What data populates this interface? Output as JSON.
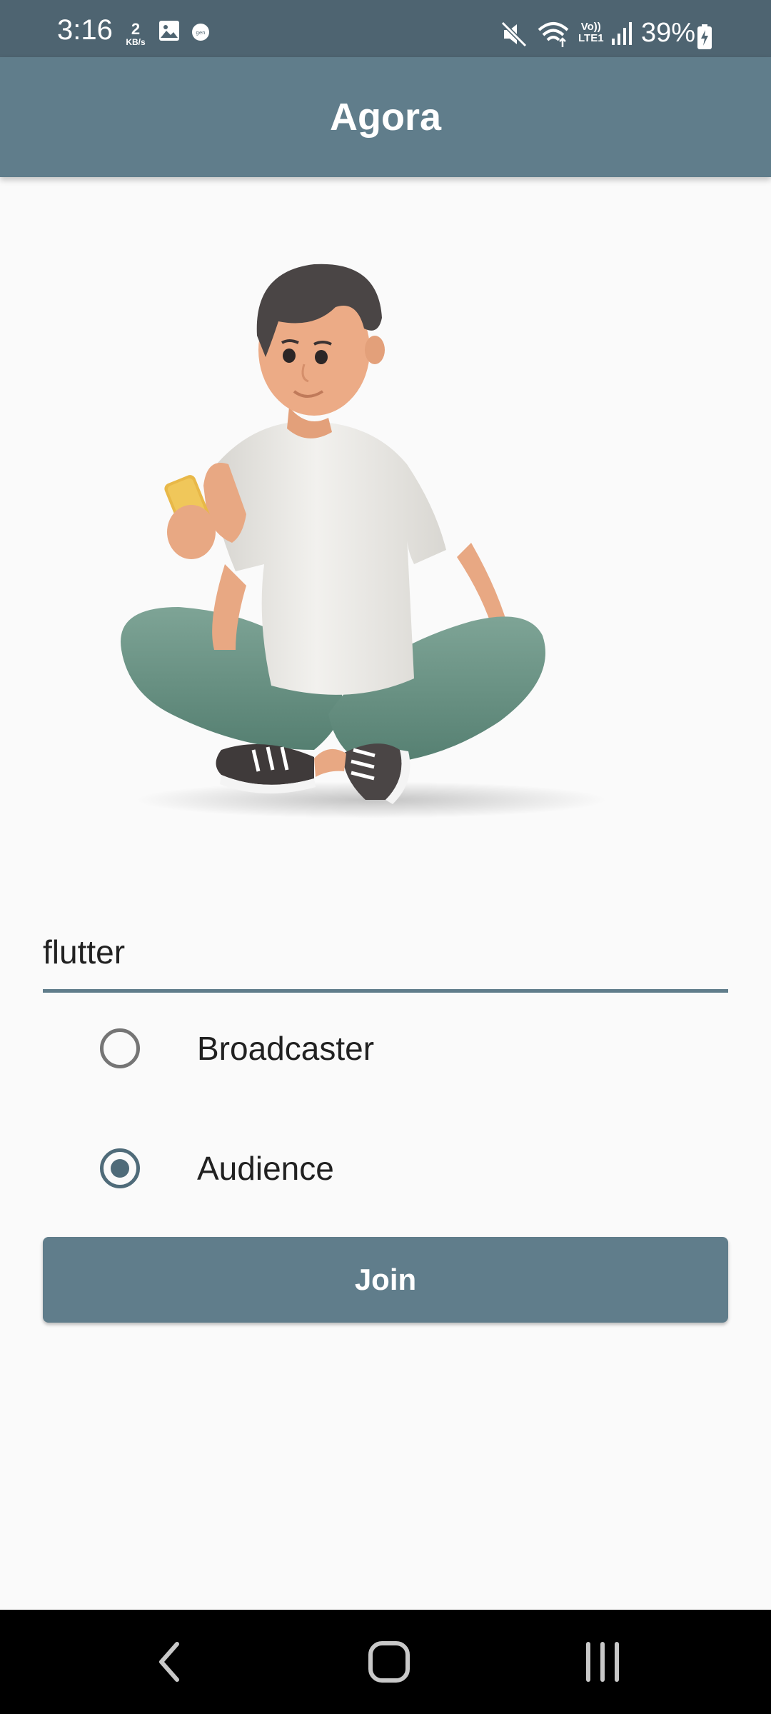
{
  "status_bar": {
    "time": "3:16",
    "net_speed_value": "2",
    "net_speed_unit": "KB/s",
    "volte_label_top": "Vo))",
    "volte_label_bottom": "LTE1",
    "battery_percent": "39%",
    "icons": [
      "gallery-icon",
      "notification-icon",
      "mute-icon",
      "wifi-icon",
      "volte-icon",
      "signal-icon",
      "battery-icon"
    ]
  },
  "app_bar": {
    "title": "Agora"
  },
  "illustration": {
    "name": "person-sitting-with-phone"
  },
  "channel": {
    "value": "flutter",
    "placeholder": ""
  },
  "role": {
    "options": [
      {
        "label": "Broadcaster",
        "selected": false
      },
      {
        "label": "Audience",
        "selected": true
      }
    ]
  },
  "join_button": {
    "label": "Join"
  },
  "nav_bar": {
    "icons": [
      "back-icon",
      "home-icon",
      "recents-icon"
    ]
  },
  "colors": {
    "primary": "#607d8b",
    "status_bar": "#4e6471",
    "background": "#fafafa",
    "radio_selected": "#4f6b79",
    "radio_unselected": "#757575",
    "nav_bar": "#000000"
  }
}
